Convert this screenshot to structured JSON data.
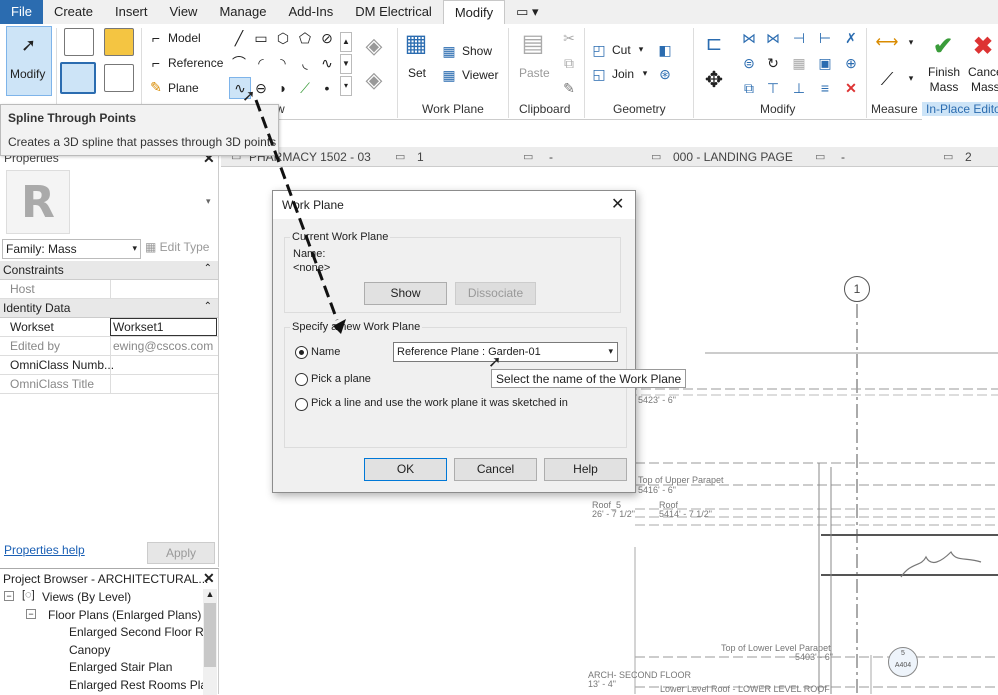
{
  "menu": [
    "File",
    "Create",
    "Insert",
    "View",
    "Manage",
    "Add-Ins",
    "DM Electrical",
    "Modify"
  ],
  "ribbon": {
    "modify_label": "Modify",
    "model_label": "Model",
    "reference_label": "Reference",
    "plane_label": "Plane",
    "show_label": "Show",
    "set_label": "Set",
    "viewer_label": "Viewer",
    "paste_label": "Paste",
    "cut_label": "Cut",
    "join_label": "Join",
    "finish_mass_label": "Finish\nMass",
    "cancel_mass_label": "Cance\nMass",
    "panels": {
      "work_plane": "Work Plane",
      "clipboard": "Clipboard",
      "geometry": "Geometry",
      "modify": "Modify",
      "measure": "Measure",
      "in_place": "In-Place Editor",
      "draw_suffix": "w"
    }
  },
  "tooltip": {
    "title": "Spline Through Points",
    "description": "Creates a 3D spline that passes through 3D points"
  },
  "properties": {
    "title": "Properties",
    "family": "Family: Mass",
    "edit_type": "Edit Type",
    "constraints": "Constraints",
    "host_label": "Host",
    "identity_data": "Identity Data",
    "workset_label": "Workset",
    "workset_value": "Workset1",
    "edited_by_label": "Edited by",
    "edited_by_value": "ewing@cscos.com",
    "omniclass_number_label": "OmniClass Numb...",
    "omniclass_title_label": "OmniClass Title",
    "help_link": "Properties help",
    "apply": "Apply"
  },
  "browser": {
    "title": "Project Browser - ARCHITECTURAL...",
    "items": [
      "Views (By Level)",
      "Floor Plans (Enlarged Plans)",
      "Enlarged Second Floor R",
      "Canopy",
      "Enlarged Stair Plan",
      "Enlarged Rest Rooms Pla"
    ]
  },
  "view_tabs": [
    "PHARMACY 1502 - 03",
    "1",
    "-",
    "000 - LANDING PAGE",
    "-",
    "2"
  ],
  "dialog": {
    "title": "Work Plane",
    "current_group": "Current Work Plane",
    "name_label": "Name:",
    "name_value": "<none>",
    "show_btn": "Show",
    "dissociate_btn": "Dissociate",
    "specify_group": "Specify a new Work Plane",
    "option_name": "Name",
    "option_pick_plane": "Pick a plane",
    "option_pick_line": "Pick a line and use the work plane it was sketched in",
    "dropdown_value": "Reference Plane : Garden-01",
    "dropdown_tooltip": "Select the name of the Work Plane",
    "ok": "OK",
    "cancel": "Cancel",
    "help": "Help"
  },
  "canvas": {
    "grid_bubble": "1",
    "labels": [
      "5423' - 6\"",
      "Top of Upper Parapet",
      "5416' - 6\"",
      "Roof_5",
      "26' - 7 1/2\"",
      "Roof",
      "5414' - 7 1/2\"",
      "Top of Lower Level Parapet",
      "5403' - 6\"",
      "ARCH- SECOND FLOOR",
      "13' - 4\"",
      "Lower Level Roof - LOWER LEVEL ROOF",
      "5",
      "A404"
    ]
  }
}
